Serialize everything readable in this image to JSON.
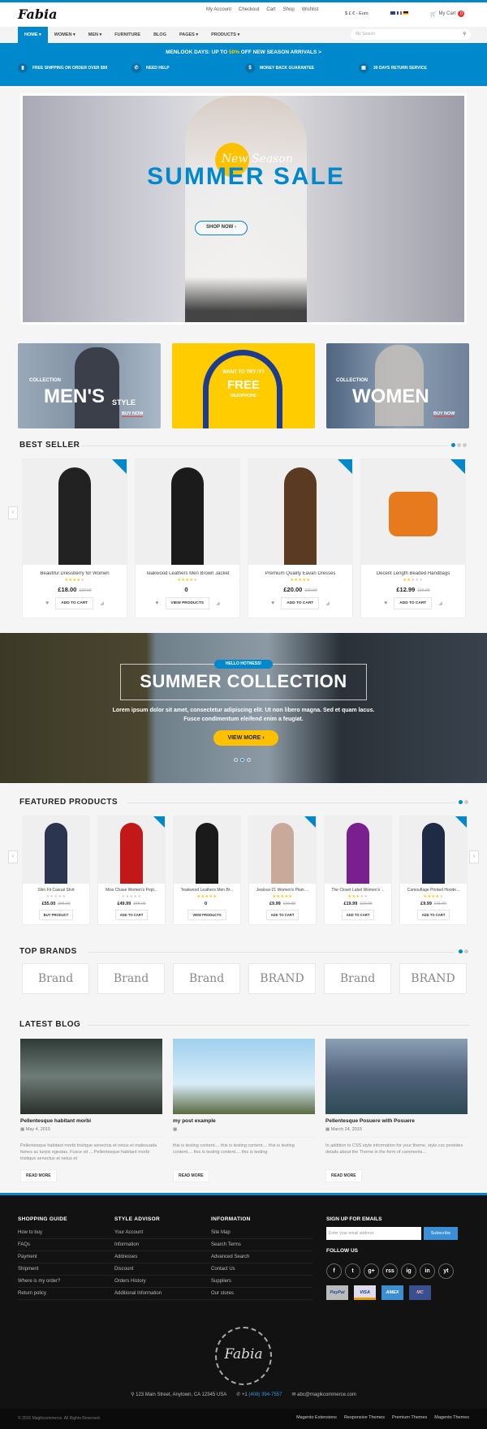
{
  "header": {
    "logo": "Fabia",
    "top_links": [
      "My Account",
      "Checkout",
      "Cart",
      "Shop",
      "Wishlist"
    ],
    "currency": "$ £ € - Euro",
    "cart_label": "My Cart",
    "cart_count": "0"
  },
  "nav": {
    "items": [
      "HOME ▾",
      "WOMEN ▾",
      "MEN ▾",
      "FURNITURE",
      "BLOG",
      "PAGES ▾",
      "PRODUCTS ▾"
    ],
    "search_placeholder": "My Search"
  },
  "promo": {
    "text_before": "MENLOOK DAYS: UP TO ",
    "highlight": "50%",
    "text_after": " OFF NEW SEASON ARRIVALS >",
    "features": [
      {
        "icon": "truck-icon",
        "label": "FREE SHIPPING ON ORDER OVER $99"
      },
      {
        "icon": "phone-icon",
        "label": "NEED HELP"
      },
      {
        "icon": "dollar-icon",
        "label": "MONEY BACK GUARANTEE"
      },
      {
        "icon": "briefcase-icon",
        "label": "30 DAYS RETURN SERVICE"
      }
    ]
  },
  "hero": {
    "script": "New Season",
    "title": "SUMMER SALE",
    "button": "SHOP NOW"
  },
  "banners": [
    {
      "pre": "COLLECTION",
      "title": "MEN'S",
      "post": "STYLE",
      "cta": "BUY NOW"
    },
    {
      "pre": "WANT TO TRY IT?",
      "title": "FREE",
      "post": "HEADPHONE"
    },
    {
      "pre": "COLLECTION",
      "title": "WOMEN",
      "cta": "BUY NOW"
    }
  ],
  "best_seller": {
    "title": "BEST SELLER",
    "products": [
      {
        "name": "Beautiful Dressberry for Women",
        "rating": 4,
        "price": "£18.00",
        "old": "£20.00",
        "button": "ADD TO CART"
      },
      {
        "name": "Teakwood Leathers Men Brown Jacket",
        "rating": 4,
        "price": "0",
        "old": "",
        "button": "VIEW PRODUCTS"
      },
      {
        "name": "Premium Quality Eavan Dresses",
        "rating": 5,
        "price": "£20.00",
        "old": "£30.00",
        "button": "ADD TO CART"
      },
      {
        "name": "Decent Length Beaded Handbags",
        "rating": 2,
        "price": "£12.99",
        "old": "£16.99",
        "button": "ADD TO CART"
      }
    ]
  },
  "collection": {
    "tag": "HELLO HOTNESS!",
    "title": "SUMMER COLLECTION",
    "text": "Lorem ipsum dolor sit amet, consectetur adipiscing elit. Ut non libero magna. Sed et quam lacus. Fusce condimentum eleifend enim a feugiat.",
    "button": "VIEW MORE"
  },
  "featured": {
    "title": "FEATURED PRODUCTS",
    "products": [
      {
        "name": "Slim Fit Casual Shirt",
        "rating": 0,
        "price": "£55.00",
        "old": "£55.00",
        "button": "BUY PRODUCT"
      },
      {
        "name": "Miss Chase Women's Pepl...",
        "rating": 0,
        "price": "£49.99",
        "old": "£65.00",
        "button": "ADD TO CART"
      },
      {
        "name": "Teakwood Leathers Men Br...",
        "rating": 5,
        "price": "0",
        "old": "",
        "button": "VIEW PRODUCTS"
      },
      {
        "name": "Jealous-21 Women's Plain ...",
        "rating": 5,
        "price": "£9.99",
        "old": "£19.00",
        "button": "ADD TO CART"
      },
      {
        "name": "The Closet Label Women's ...",
        "rating": 3,
        "price": "£19.99",
        "old": "£19.00",
        "button": "ADD TO CART"
      },
      {
        "name": "Camouflage Printed Hoode...",
        "rating": 4,
        "price": "£9.99",
        "old": "£11.00",
        "button": "ADD TO CART"
      }
    ]
  },
  "brands": {
    "title": "TOP BRANDS",
    "items": [
      "Brand",
      "Brand",
      "Brand",
      "BRAND",
      "Brand",
      "BRAND"
    ]
  },
  "blog": {
    "title": "LATEST BLOG",
    "posts": [
      {
        "title": "Pellentesque habitant morbi",
        "date": "May 4, 2015",
        "text": "Pellentesque habitant morbi tristique senectus et netus et malesuada fames ac turpis egestas. Fusce sit ... Pellentesque habitant morbi tristique senectus et netus et",
        "button": "READ MORE"
      },
      {
        "title": "my post example",
        "date": "",
        "text": "this is testing content.... this is testing content.... this is testing content.... this is testing content.... this is testing",
        "button": "READ MORE"
      },
      {
        "title": "Pellentesque Posuere with Posuere",
        "date": "March 24, 2015",
        "text": "In addition to CSS style information for your theme, style.css provides details about the Theme in the form of comments...",
        "button": "READ MORE"
      }
    ]
  },
  "footer": {
    "columns": [
      {
        "title": "SHOPPING GUIDE",
        "links": [
          "How to buy",
          "FAQs",
          "Payment",
          "Shipment",
          "Where is my order?",
          "Return policy"
        ]
      },
      {
        "title": "STYLE ADVISOR",
        "links": [
          "Your Account",
          "Information",
          "Addresses",
          "Discount",
          "Orders History",
          "Additional Information"
        ]
      },
      {
        "title": "INFORMATION",
        "links": [
          "Site Map",
          "Search Terms",
          "Advanced Search",
          "Contact Us",
          "Suppliers",
          "Our stores"
        ]
      }
    ],
    "signup_title": "SIGN UP FOR EMAILS",
    "email_placeholder": "Enter your email address",
    "subscribe": "Subscribe",
    "follow_title": "FOLLOW US",
    "social": [
      "f",
      "t",
      "g+",
      "rss",
      "ig",
      "in",
      "yt"
    ],
    "payments": [
      "PayPal",
      "VISA",
      "AMEX",
      "MC"
    ],
    "logo": "Fabia",
    "address": "123 Main Street, Anytown, CA 12345 USA",
    "phone_prefix": "+1",
    "phone": "(408) 394-7557",
    "email": "abc@magikcommerce.com",
    "copyright": "© 2015 Magikcommerce. All Rights Reserved.",
    "bottom_links": [
      "Magento Extensions",
      "Responsive Themes",
      "Premium Themes",
      "Magento Themes"
    ]
  },
  "colors": {
    "accent": "#0088cc",
    "yellow": "#ffc000",
    "footer_bg": "#121212"
  }
}
